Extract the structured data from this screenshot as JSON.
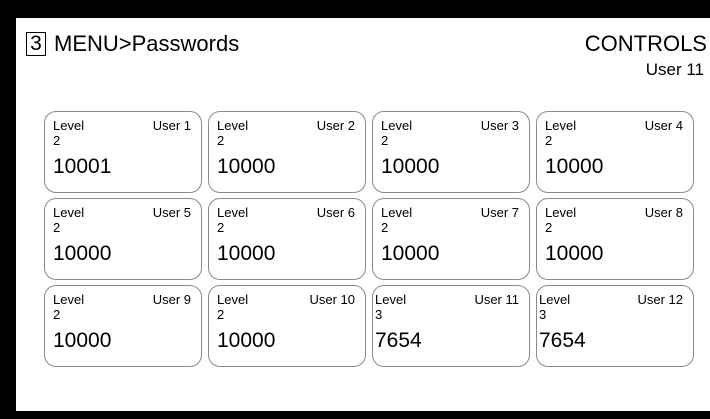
{
  "header": {
    "page_number": "3",
    "title": "MENU>Passwords",
    "section": "CONTROLS",
    "current_user": "User 11"
  },
  "cards": [
    {
      "level_label": "Level",
      "level": "2",
      "user": "User 1",
      "password": "10001"
    },
    {
      "level_label": "Level",
      "level": "2",
      "user": "User 2",
      "password": "10000"
    },
    {
      "level_label": "Level",
      "level": "2",
      "user": "User 3",
      "password": "10000"
    },
    {
      "level_label": "Level",
      "level": "2",
      "user": "User 4",
      "password": "10000"
    },
    {
      "level_label": "Level",
      "level": "2",
      "user": "User 5",
      "password": "10000"
    },
    {
      "level_label": "Level",
      "level": "2",
      "user": "User 6",
      "password": "10000"
    },
    {
      "level_label": "Level",
      "level": "2",
      "user": "User 7",
      "password": "10000"
    },
    {
      "level_label": "Level",
      "level": "2",
      "user": "User 8",
      "password": "10000"
    },
    {
      "level_label": "Level",
      "level": "2",
      "user": "User 9",
      "password": "10000"
    },
    {
      "level_label": "Level",
      "level": "2",
      "user": "User 10",
      "password": "10000"
    },
    {
      "level_label": "Level",
      "level": "3",
      "user": "User 11",
      "password": "7654"
    },
    {
      "level_label": "Level",
      "level": "3",
      "user": "User 12",
      "password": "7654"
    }
  ]
}
